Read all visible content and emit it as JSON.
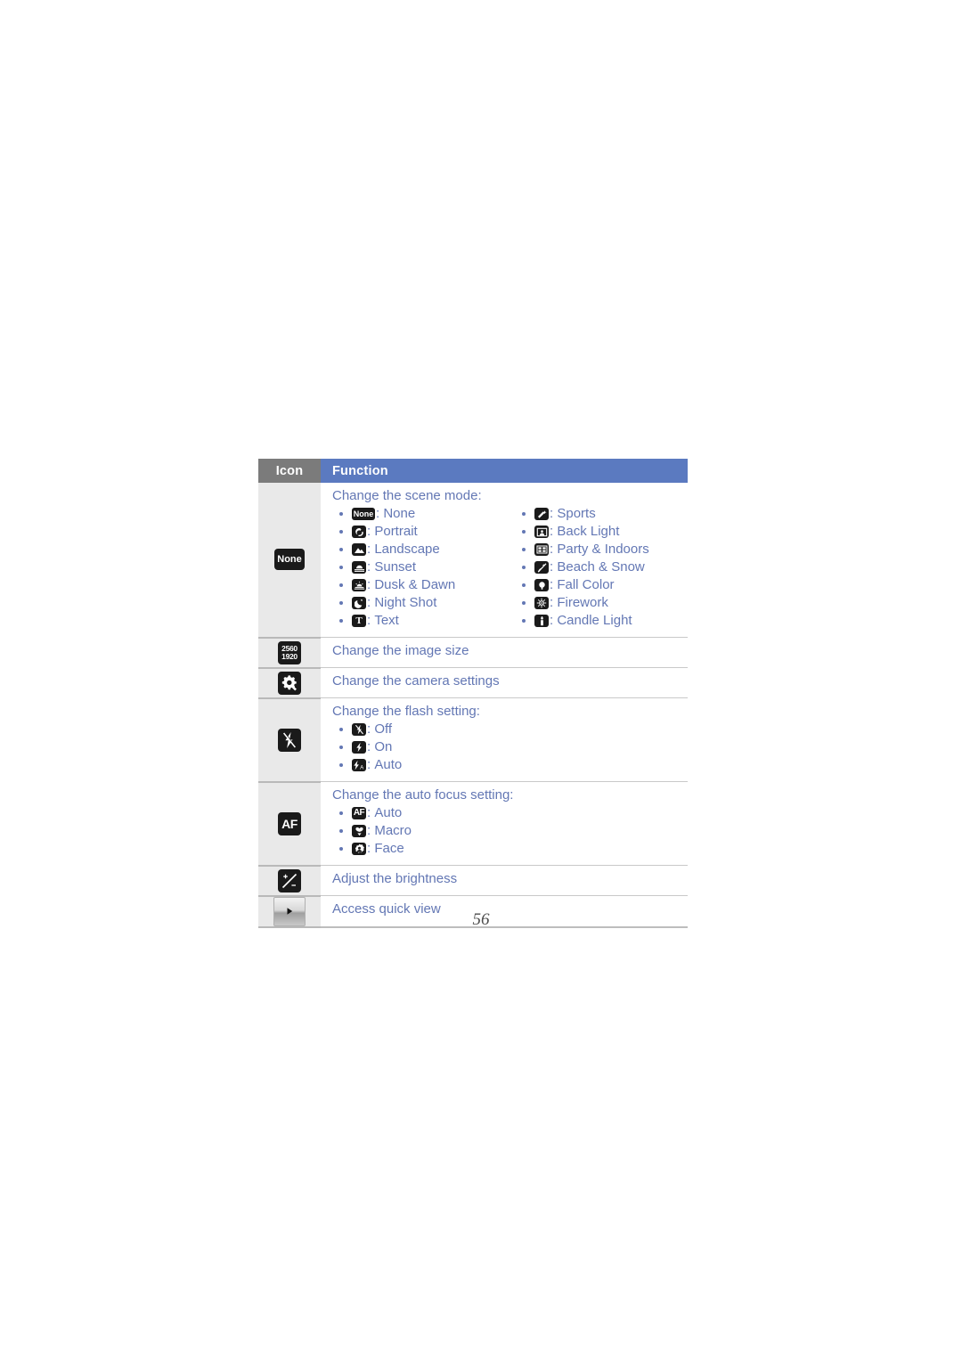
{
  "document": {
    "page_number": "56",
    "accent_text_color": "#6377b4",
    "header_gray": "#7b7b7b",
    "header_blue": "#5b7ac0",
    "icon_cell_gray": "#e9e9e9"
  },
  "table": {
    "columns": [
      "Icon",
      "Function"
    ],
    "rows": [
      {
        "id": "scene-mode",
        "icon_name": "scene-mode-none-icon",
        "icon_label": "None",
        "title": "Change the scene mode:",
        "options_left": [
          {
            "icon": "scene-none-icon",
            "label": "None"
          },
          {
            "icon": "scene-portrait-icon",
            "label": "Portrait"
          },
          {
            "icon": "scene-landscape-icon",
            "label": "Landscape"
          },
          {
            "icon": "scene-sunset-icon",
            "label": "Sunset"
          },
          {
            "icon": "scene-dusk-dawn-icon",
            "label": "Dusk & Dawn"
          },
          {
            "icon": "scene-night-shot-icon",
            "label": "Night Shot"
          },
          {
            "icon": "scene-text-icon",
            "label": "Text"
          }
        ],
        "options_right": [
          {
            "icon": "scene-sports-icon",
            "label": "Sports"
          },
          {
            "icon": "scene-back-light-icon",
            "label": "Back Light"
          },
          {
            "icon": "scene-party-indoors-icon",
            "label": "Party & Indoors"
          },
          {
            "icon": "scene-beach-snow-icon",
            "label": "Beach & Snow"
          },
          {
            "icon": "scene-fall-color-icon",
            "label": "Fall Color"
          },
          {
            "icon": "scene-firework-icon",
            "label": "Firework"
          },
          {
            "icon": "scene-candle-light-icon",
            "label": "Candle Light"
          }
        ]
      },
      {
        "id": "image-size",
        "icon_name": "image-size-icon",
        "icon_label_top": "2560",
        "icon_label_bottom": "1920",
        "title": "Change the image size",
        "options_left": [],
        "options_right": []
      },
      {
        "id": "camera-settings",
        "icon_name": "camera-settings-gear-icon",
        "title": "Change the camera settings",
        "options_left": [],
        "options_right": []
      },
      {
        "id": "flash",
        "icon_name": "flash-off-icon",
        "title": "Change the flash setting:",
        "options_left": [
          {
            "icon": "flash-off-icon",
            "label": "Off"
          },
          {
            "icon": "flash-on-icon",
            "label": "On"
          },
          {
            "icon": "flash-auto-icon",
            "label": "Auto"
          }
        ],
        "options_right": []
      },
      {
        "id": "auto-focus",
        "icon_name": "auto-focus-af-icon",
        "icon_label": "AF",
        "title": "Change the auto focus setting:",
        "options_left": [
          {
            "icon": "focus-auto-af-icon",
            "label": "Auto"
          },
          {
            "icon": "focus-macro-icon",
            "label": "Macro"
          },
          {
            "icon": "focus-face-icon",
            "label": "Face"
          }
        ],
        "options_right": []
      },
      {
        "id": "brightness",
        "icon_name": "brightness-exposure-icon",
        "title": "Adjust the brightness",
        "options_left": [],
        "options_right": []
      },
      {
        "id": "quick-view",
        "icon_name": "quick-view-play-icon",
        "title": "Access quick view",
        "options_left": [],
        "options_right": []
      }
    ]
  }
}
